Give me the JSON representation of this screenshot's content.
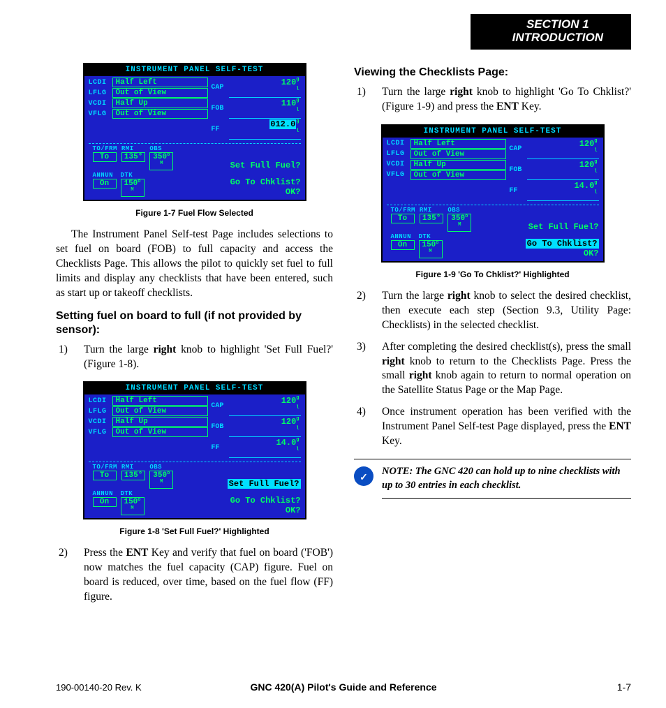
{
  "section_header": {
    "line1": "SECTION 1",
    "line2": "INTRODUCTION"
  },
  "panel_common_title": "INSTRUMENT PANEL SELF-TEST",
  "fig17": {
    "caption": "Figure 1-7  Fuel Flow Selected",
    "lcdi": "Half Left",
    "lflg": "Out of View",
    "vcdi": "Half Up",
    "vflg": "Out of View",
    "cap": "120",
    "fob": "110",
    "ff": "012.0",
    "to_frm": "To",
    "rmi": "135°",
    "obs": "350",
    "annun": "On",
    "dtk": "150",
    "prompt1": "Set Full Fuel?",
    "prompt2": "Go To Chklist?",
    "prompt3": "OK?",
    "ff_highlighted": true
  },
  "fig18": {
    "caption": "Figure 1-8  'Set Full Fuel?' Highlighted",
    "lcdi": "Half Left",
    "lflg": "Out of View",
    "vcdi": "Half Up",
    "vflg": "Out of View",
    "cap": "120",
    "fob": "120",
    "ff": "14.0",
    "to_frm": "To",
    "rmi": "135°",
    "obs": "350",
    "annun": "On",
    "dtk": "150",
    "prompt1": "Set Full Fuel?",
    "prompt2": "Go To Chklist?",
    "prompt3": "OK?",
    "set_full_highlighted": true
  },
  "fig19": {
    "caption": "Figure 1-9  'Go To Chklist?' Highlighted",
    "lcdi": "Half Left",
    "lflg": "Out of View",
    "vcdi": "Half Up",
    "vflg": "Out of View",
    "cap": "120",
    "fob": "120",
    "ff": "14.0",
    "to_frm": "To",
    "rmi": "135°",
    "obs": "350",
    "annun": "On",
    "dtk": "150",
    "prompt1": "Set Full Fuel?",
    "prompt2": "Go To Chklist?",
    "prompt3": "OK?",
    "goto_highlighted": true
  },
  "lbl_lcdi": "LCDI",
  "lbl_lflg": "LFLG",
  "lbl_vcdi": "VCDI",
  "lbl_vflg": "VFLG",
  "lbl_cap": "CAP",
  "lbl_fob": "FOB",
  "lbl_ff": "FF",
  "lbl_tofrm": "TO/FRM",
  "lbl_rmi": "RMI",
  "lbl_obs": "OBS",
  "lbl_annun": "ANNUN",
  "lbl_dtk": "DTK",
  "para_selftest": "The Instrument Panel Self-test Page includes selections to set fuel on board (FOB) to full capacity and access the Checklists Page.  This allows the pilot to quickly set fuel to full limits and display any checklists that have been entered, such as start up or takeoff checklists.",
  "subhead_fuel": "Setting fuel on board to full (if not provided by sensor):",
  "fuel_step1_a": "Turn the large ",
  "bold_right": "right",
  "fuel_step1_b": " knob to highlight 'Set Full Fuel?' (Figure 1-8).",
  "fuel_step2_a": "Press the ",
  "bold_ent": "ENT",
  "fuel_step2_b": " Key and verify that fuel on board ('FOB') now matches the fuel capacity (CAP) figure.  Fuel on board is reduced, over time, based on the fuel flow (FF) figure.",
  "subhead_chk": "Viewing the Checklists Page:",
  "chk_step1_a": "Turn the large ",
  "chk_step1_b": " knob to highlight 'Go To Chklist?' (Figure 1-9) and press the ",
  "chk_step1_c": " Key.",
  "chk_step2_a": "Turn the large ",
  "chk_step2_b": " knob to select the desired checklist, then execute each step (Section 9.3, Utility Page: Checklists) in the selected checklist.",
  "chk_step3_a": "After completing the desired checklist(s), press the small ",
  "chk_step3_b": " knob to return to the Checklists Page.  Press the small ",
  "chk_step3_c": " knob again to return to normal operation on the Satellite Status Page or the Map Page.",
  "chk_step4_a": "Once instrument operation has been verified with the Instrument Panel Self-test Page displayed, press the ",
  "chk_step4_b": " Key.",
  "note_text": "NOTE: The GNC 420 can hold up to nine checklists with up to 30 entries in each checklist.",
  "footer_left": "190-00140-20  Rev. K",
  "footer_center": "GNC 420(A) Pilot's Guide and Reference",
  "footer_right": "1-7"
}
